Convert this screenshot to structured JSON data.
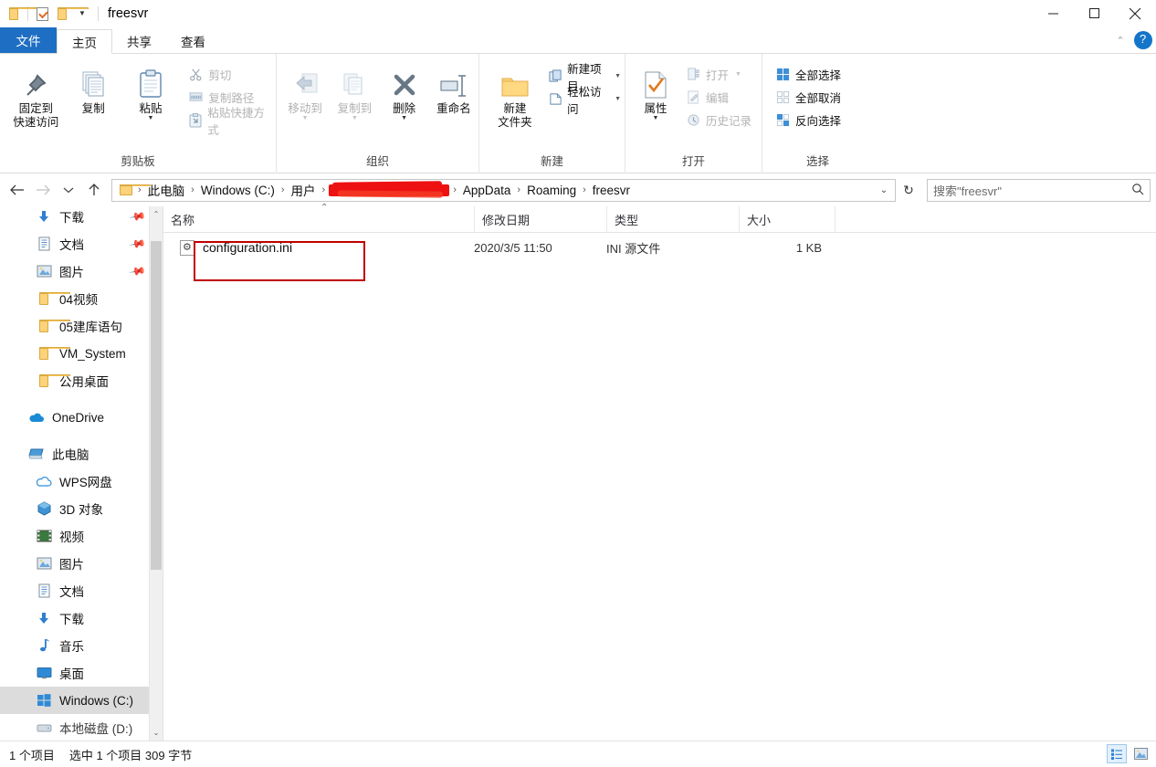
{
  "window": {
    "title": "freesvr",
    "quick_access": [
      {
        "name": "folder-icon",
        "label": "文件夹"
      },
      {
        "name": "properties-icon",
        "label": "属性"
      },
      {
        "name": "new-folder-icon",
        "label": "新建文件夹"
      },
      {
        "name": "customize-caret",
        "label": "▼"
      }
    ],
    "controls": {
      "minimize": "—",
      "maximize": "▢",
      "close": "✕"
    }
  },
  "tabs": {
    "file": "文件",
    "items": [
      {
        "label": "主页",
        "active": true
      },
      {
        "label": "共享",
        "active": false
      },
      {
        "label": "查看",
        "active": false
      }
    ],
    "collapse_icon": "chevron-up-icon",
    "help_icon": "help-icon"
  },
  "ribbon": {
    "groups": [
      {
        "label": "剪贴板",
        "big": [
          {
            "label": "固定到\n快速访问",
            "icon": "pin-icon",
            "caret": true,
            "dim": false
          },
          {
            "label": "复制",
            "icon": "copy-icon",
            "dim": false
          },
          {
            "label": "粘贴",
            "icon": "paste-icon",
            "caret": true,
            "dim": false
          }
        ],
        "small": [
          {
            "label": "剪切",
            "icon": "scissors-icon",
            "dim": true
          },
          {
            "label": "复制路径",
            "icon": "copy-path-icon",
            "dim": true
          },
          {
            "label": "粘贴快捷方式",
            "icon": "paste-shortcut-icon",
            "dim": true
          }
        ]
      },
      {
        "label": "组织",
        "big": [
          {
            "label": "移动到",
            "icon": "move-to-icon",
            "caret": true,
            "dim": true
          },
          {
            "label": "复制到",
            "icon": "copy-to-icon",
            "caret": true,
            "dim": true
          },
          {
            "label": "删除",
            "icon": "delete-icon",
            "caret": true,
            "dim": false
          },
          {
            "label": "重命名",
            "icon": "rename-icon",
            "dim": false
          }
        ],
        "small": []
      },
      {
        "label": "新建",
        "big": [
          {
            "label": "新建\n文件夹",
            "icon": "new-folder-icon",
            "dim": false
          }
        ],
        "small": [
          {
            "label": "新建项目",
            "icon": "new-item-icon",
            "caret": true,
            "dim": false
          },
          {
            "label": "轻松访问",
            "icon": "easy-access-icon",
            "caret": true,
            "dim": false
          }
        ]
      },
      {
        "label": "打开",
        "big": [
          {
            "label": "属性",
            "icon": "properties-icon",
            "caret": true,
            "dim": false
          }
        ],
        "small": [
          {
            "label": "打开",
            "icon": "open-icon",
            "caret": true,
            "dim": true
          },
          {
            "label": "编辑",
            "icon": "edit-icon",
            "dim": true
          },
          {
            "label": "历史记录",
            "icon": "history-icon",
            "dim": true
          }
        ]
      },
      {
        "label": "选择",
        "big": [],
        "small": [
          {
            "label": "全部选择",
            "icon": "select-all-icon",
            "dim": false
          },
          {
            "label": "全部取消",
            "icon": "select-none-icon",
            "dim": false
          },
          {
            "label": "反向选择",
            "icon": "invert-selection-icon",
            "dim": false
          }
        ]
      }
    ]
  },
  "addressbar": {
    "back_icon": "arrow-left-icon",
    "forward_icon": "arrow-right-icon",
    "recent_icon": "chevron-down-icon",
    "up_icon": "arrow-up-icon",
    "folder_icon": "folder-icon",
    "crumbs": [
      "此电脑",
      "Windows (C:)",
      "用户",
      "[redacted]",
      "AppData",
      "Roaming",
      "freesvr"
    ],
    "redacted_index": 3,
    "dropdown_icon": "chevron-down-icon",
    "refresh_icon": "refresh-icon",
    "search_placeholder": "搜索\"freesvr\"",
    "search_value": "",
    "search_icon": "search-icon"
  },
  "sidebar": {
    "items": [
      {
        "label": "下载",
        "icon": "download-icon",
        "pinned": true,
        "indent": true,
        "selected": false
      },
      {
        "label": "文档",
        "icon": "document-icon",
        "pinned": true,
        "indent": true,
        "selected": false
      },
      {
        "label": "图片",
        "icon": "picture-icon",
        "pinned": true,
        "indent": true,
        "selected": false
      },
      {
        "label": "04视频",
        "icon": "folder-icon",
        "pinned": false,
        "indent": true,
        "selected": false
      },
      {
        "label": "05建库语句",
        "icon": "folder-icon",
        "pinned": false,
        "indent": true,
        "selected": false
      },
      {
        "label": "VM_System",
        "icon": "folder-icon",
        "pinned": false,
        "indent": true,
        "selected": false
      },
      {
        "label": "公用桌面",
        "icon": "folder-icon",
        "pinned": false,
        "indent": true,
        "selected": false
      },
      {
        "label": "",
        "icon": "",
        "spacer": true
      },
      {
        "label": "OneDrive",
        "icon": "onedrive-icon",
        "pinned": false,
        "indent": false,
        "selected": false
      },
      {
        "label": "",
        "icon": "",
        "spacer": true
      },
      {
        "label": "此电脑",
        "icon": "this-pc-icon",
        "pinned": false,
        "indent": false,
        "selected": false
      },
      {
        "label": "WPS网盘",
        "icon": "wps-cloud-icon",
        "pinned": false,
        "indent": true,
        "selected": false
      },
      {
        "label": "3D 对象",
        "icon": "3d-objects-icon",
        "pinned": false,
        "indent": true,
        "selected": false
      },
      {
        "label": "视频",
        "icon": "video-icon",
        "pinned": false,
        "indent": true,
        "selected": false
      },
      {
        "label": "图片",
        "icon": "picture-icon",
        "pinned": false,
        "indent": true,
        "selected": false
      },
      {
        "label": "文档",
        "icon": "document-icon",
        "pinned": false,
        "indent": true,
        "selected": false
      },
      {
        "label": "下载",
        "icon": "download-icon",
        "pinned": false,
        "indent": true,
        "selected": false
      },
      {
        "label": "音乐",
        "icon": "music-icon",
        "pinned": false,
        "indent": true,
        "selected": false
      },
      {
        "label": "桌面",
        "icon": "desktop-icon",
        "pinned": false,
        "indent": true,
        "selected": false
      },
      {
        "label": "Windows (C:)",
        "icon": "drive-windows-icon",
        "pinned": false,
        "indent": true,
        "selected": true
      },
      {
        "label": "本地磁盘 (D:)",
        "icon": "drive-icon",
        "pinned": false,
        "indent": true,
        "selected": false
      }
    ],
    "scroll_up_icon": "chevron-up-icon",
    "scroll_down_icon": "chevron-down-icon"
  },
  "filelist": {
    "columns": [
      {
        "label": "名称",
        "sorted": true,
        "sort_dir": "asc"
      },
      {
        "label": "修改日期",
        "sorted": false
      },
      {
        "label": "类型",
        "sorted": false
      },
      {
        "label": "大小",
        "sorted": false
      }
    ],
    "rows": [
      {
        "name": "configuration.ini",
        "icon": "ini-file-icon",
        "modified": "2020/3/5 11:50",
        "type": "INI 源文件",
        "size": "1 KB",
        "highlighted": true
      }
    ],
    "highlight_color": "#c00000"
  },
  "statusbar": {
    "item_count": "1 个项目",
    "selection": "选中 1 个项目 309 字节",
    "views": [
      {
        "name": "details-view-button",
        "active": true
      },
      {
        "name": "large-icons-view-button",
        "active": false
      }
    ]
  }
}
